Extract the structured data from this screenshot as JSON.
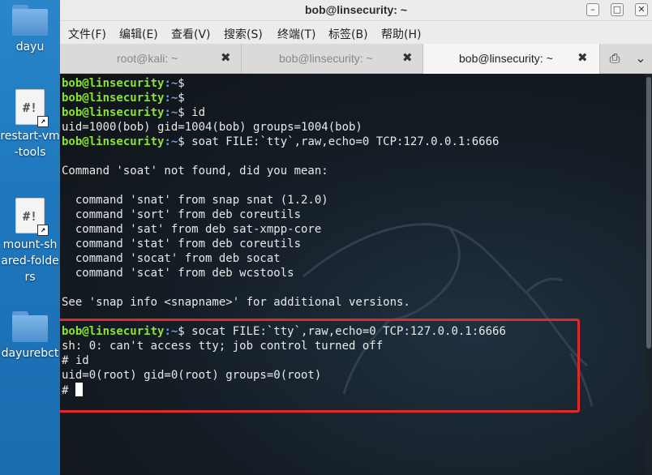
{
  "desktop": {
    "icons": [
      {
        "label": "dayu",
        "icon": "folder-icon"
      },
      {
        "label": "restart-vm-tools",
        "icon": "script-icon"
      },
      {
        "label": "mount-shared-folders",
        "icon": "script-icon"
      },
      {
        "label": "dayurebct",
        "icon": "folder-icon"
      }
    ]
  },
  "window": {
    "title": "bob@linsecurity: ~",
    "controls": {
      "minimize": "–",
      "maximize": "□",
      "close": "✕"
    }
  },
  "menubar": {
    "items": [
      "文件(F)",
      "编辑(E)",
      "查看(V)",
      "搜索(S)",
      "终端(T)",
      "标签(B)",
      "帮助(H)"
    ]
  },
  "tabs": [
    {
      "label": "root@kali: ~",
      "close": "✖",
      "active": false
    },
    {
      "label": "bob@linsecurity: ~",
      "close": "✖",
      "active": false
    },
    {
      "label": "bob@linsecurity: ~",
      "close": "✖",
      "active": true
    }
  ],
  "tabbar": {
    "new_tab_icon": "⎙",
    "scroll_icon": "⌄"
  },
  "terminal": {
    "prompt_user": "bob@linsecurity",
    "prompt_path": ":~",
    "prompt_sign": "$",
    "lines": [
      {
        "type": "prompt",
        "cmd": ""
      },
      {
        "type": "prompt",
        "cmd": ""
      },
      {
        "type": "prompt",
        "cmd": " id"
      },
      {
        "type": "out",
        "text": "uid=1000(bob) gid=1004(bob) groups=1004(bob)"
      },
      {
        "type": "prompt",
        "cmd": " soat FILE:`tty`,raw,echo=0 TCP:127.0.0.1:6666"
      },
      {
        "type": "out",
        "text": ""
      },
      {
        "type": "out",
        "text": "Command 'soat' not found, did you mean:"
      },
      {
        "type": "out",
        "text": ""
      },
      {
        "type": "out",
        "text": "  command 'snat' from snap snat (1.2.0)"
      },
      {
        "type": "out",
        "text": "  command 'sort' from deb coreutils"
      },
      {
        "type": "out",
        "text": "  command 'sat' from deb sat-xmpp-core"
      },
      {
        "type": "out",
        "text": "  command 'stat' from deb coreutils"
      },
      {
        "type": "out",
        "text": "  command 'socat' from deb socat"
      },
      {
        "type": "out",
        "text": "  command 'scat' from deb wcstools"
      },
      {
        "type": "out",
        "text": ""
      },
      {
        "type": "out",
        "text": "See 'snap info <snapname>' for additional versions."
      },
      {
        "type": "out",
        "text": ""
      },
      {
        "type": "prompt",
        "cmd": " socat FILE:`tty`,raw,echo=0 TCP:127.0.0.1:6666"
      },
      {
        "type": "out",
        "text": "sh: 0: can't access tty; job control turned off"
      },
      {
        "type": "out",
        "text": "# id"
      },
      {
        "type": "out",
        "text": "uid=0(root) gid=0(root) groups=0(root)"
      },
      {
        "type": "cursor",
        "text": "# "
      }
    ],
    "colors": {
      "user": "#8ae234",
      "path": "#729fcf",
      "text": "#e8e8e8",
      "highlight": "#e02a2a"
    }
  }
}
